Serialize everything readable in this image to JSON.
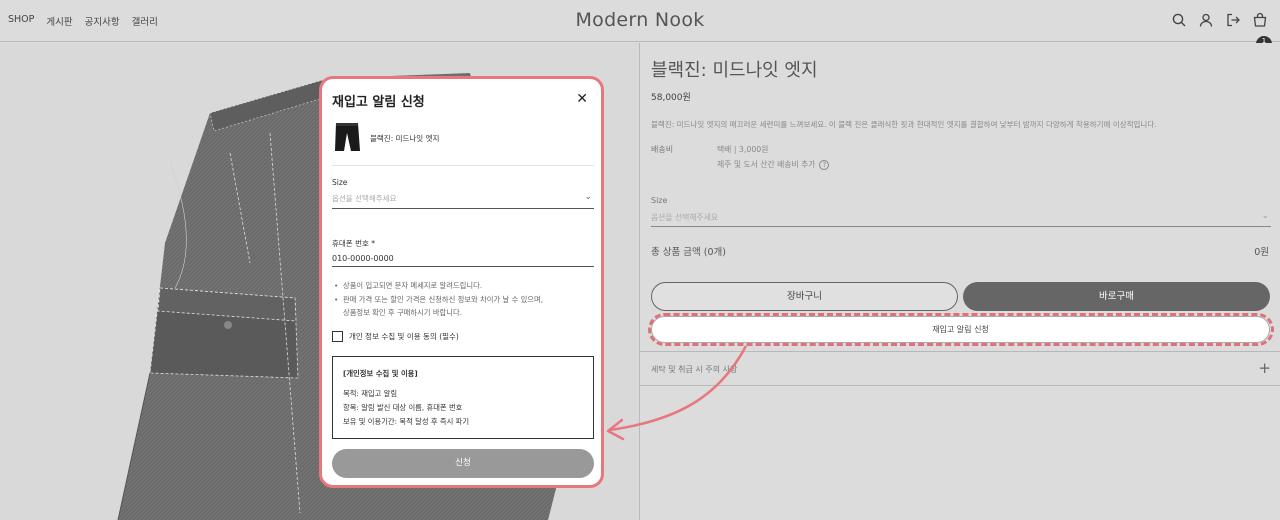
{
  "header": {
    "nav": [
      "SHOP",
      "게시판",
      "공지사항",
      "갤러리"
    ],
    "logo": "Modern Nook",
    "cart_count": "1",
    "icons": [
      "search-icon",
      "user-icon",
      "logout-icon",
      "cart-icon"
    ]
  },
  "product": {
    "title": "블랙진: 미드나잇 엣지",
    "price": "58,000원",
    "description": "블랙진: 미드나잇 엣지의 매끄러운 세련미를 느껴보세요. 이 블랙 진은 클래식한 핏과 현대적인 엣지를 결합하여 낮부터 밤까지 다양하게 착용하기에 이상적입니다.",
    "shipping_label": "배송비",
    "shipping_value": "택배 | 3,000원",
    "shipping_note": "제주 및 도서 산간 배송비 추가",
    "size_label": "Size",
    "size_placeholder": "옵션을 선택해주세요",
    "total_label": "총 상품 금액 (0개)",
    "total_value": "0원",
    "cart_button": "장바구니",
    "buy_button": "바로구매",
    "restock_button": "재입고 알림 신청",
    "care_label": "세탁 및 취급 시 주의 사항",
    "care_toggle": "+"
  },
  "modal": {
    "title": "재입고 알림 신청",
    "close": "✕",
    "product_name": "블랙진: 미드나잇 엣지",
    "size_label": "Size",
    "size_placeholder": "옵션을 선택해주세요",
    "phone_label": "휴대폰 번호",
    "phone_required": "*",
    "phone_value": "010-0000-0000",
    "notes": [
      "상품이 입고되면 문자 메세지로 알려드립니다.",
      "판매 가격 또는 할인 가격은 신청하신 정보와 차이가 날 수 있으며,",
      "상품정보 확인 후 구매하시기 바랍니다."
    ],
    "agree_label": "개인 정보 수집 및 이용 동의 (필수)",
    "privacy_title": "[개인정보 수집 및 이용]",
    "privacy_lines": [
      "목적: 재입고 알림",
      "항목: 알림 발신 대상 이름, 휴대폰 번호",
      "보유 및 이용기간: 목적 달성 후 즉시 파기"
    ],
    "submit": "신청"
  },
  "colors": {
    "highlight": "#e8767d",
    "buy_button": "#666666",
    "submit_button": "#999999"
  }
}
